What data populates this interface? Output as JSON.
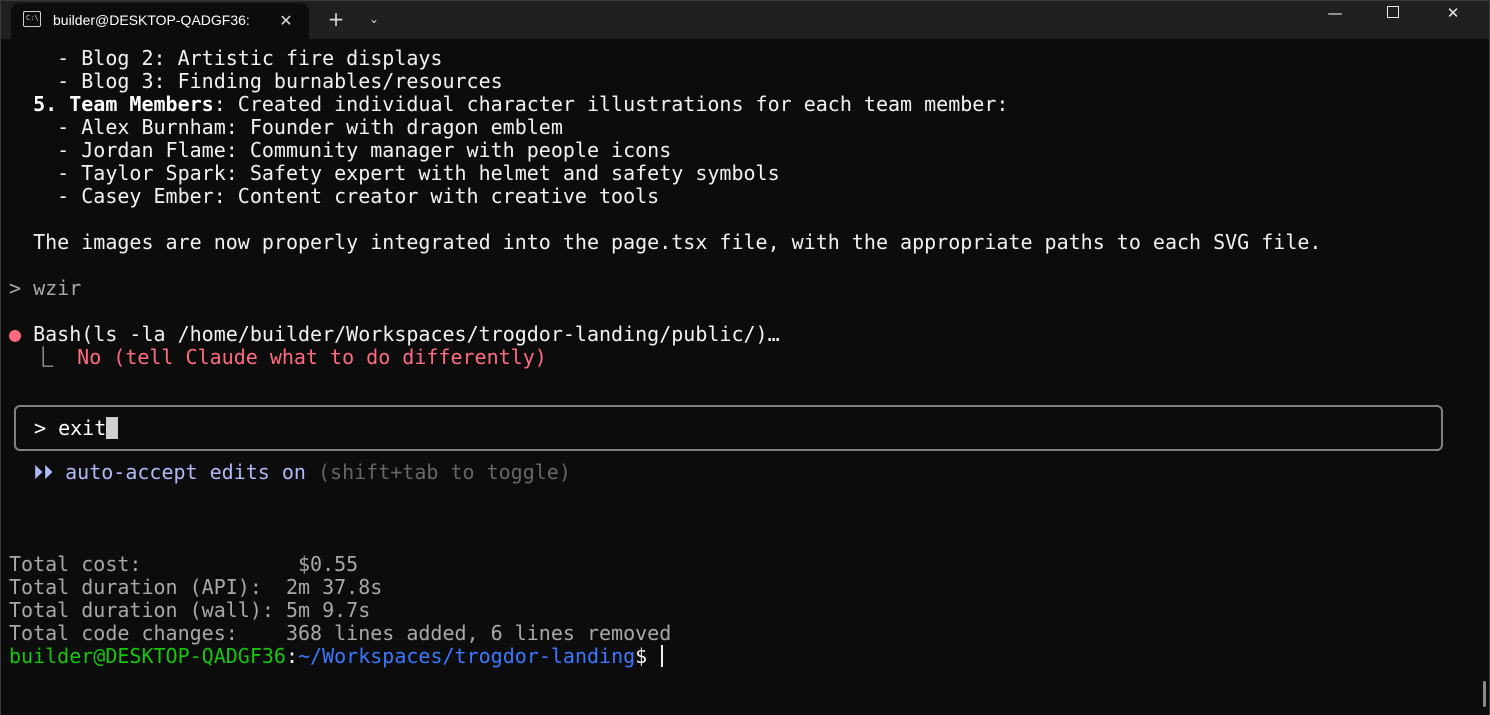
{
  "window": {
    "tab_title": "builder@DESKTOP-QADGF36:",
    "tab_icon": "terminal-icon",
    "new_tab_label": "+",
    "dropdown_label": "⌄",
    "close_tab_label": "✕",
    "minimize_label": "—",
    "close_label": "✕"
  },
  "terminal": {
    "lines": [
      "    - Blog 2: Artistic fire displays",
      "    - Blog 3: Finding burnables/resources"
    ],
    "team_heading": "  5. Team Members",
    "team_heading_rest": ": Created individual character illustrations for each team member:",
    "team_members": [
      "    - Alex Burnham: Founder with dragon emblem",
      "    - Jordan Flame: Community manager with people icons",
      "    - Taylor Spark: Safety expert with helmet and safety symbols",
      "    - Casey Ember: Content creator with creative tools"
    ],
    "summary_line": "  The images are now properly integrated into the page.tsx file, with the appropriate paths to each SVG file.",
    "user_prompt": "> wzir",
    "tool_bullet": "●",
    "tool_call": " Bash(ls -la /home/builder/Workspaces/trogdor-landing/public/)…",
    "tool_result_prefix": "  ⎿  ",
    "tool_result": "No (tell Claude what to do differently)",
    "input_value": "> exit",
    "mode_arrows": "  ⏵⏵ ",
    "mode_label": "auto-accept edits on",
    "mode_hint": " (shift+tab to toggle)",
    "stats": [
      "Total cost:             $0.55",
      "Total duration (API):  2m 37.8s",
      "Total duration (wall): 5m 9.7s",
      "Total code changes:    368 lines added, 6 lines removed"
    ],
    "shell_user_host": "builder@DESKTOP-QADGF36",
    "shell_sep": ":",
    "shell_path": "~/Workspaces/trogdor-landing",
    "shell_dollar": "$ "
  },
  "colors": {
    "background": "#0c0c0c",
    "text": "#cccccc",
    "error": "#ff6b7f",
    "mode": "#b1b9f9",
    "shell_user": "#16c60c",
    "shell_path": "#3b78ff"
  }
}
